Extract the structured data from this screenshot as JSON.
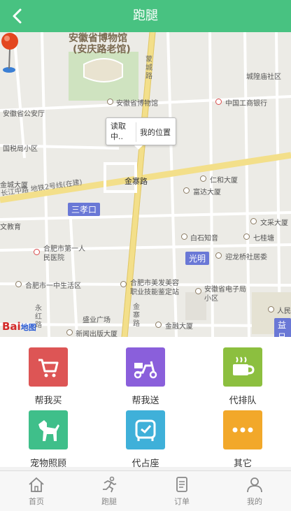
{
  "header": {
    "title": "跑腿",
    "back_icon": "chevron-left-icon"
  },
  "map": {
    "labels": {
      "museum": "安徽省博物馆",
      "museum_sub": "(安庆路老馆)",
      "museum_poi": "安徽省博物馆",
      "mengcheng_road": "蒙城路",
      "chenglong": "城隍庙社区",
      "icbc": "中国工商银行",
      "gongan": "安徽省公安厅",
      "guoshui": "国税局小区",
      "jinchengdasha": "金城大厦",
      "renhe": "仁和大厦",
      "fuda": "富达大厦",
      "metro": "长江中路 地铁2号线(在建)",
      "jinzhai": "金寨路",
      "sanxiaokou": "三孝口",
      "wenjiao": "文教育",
      "wenmi": "文采大厦",
      "baishi": "白石知音",
      "qigui": "七桂塘",
      "guangming": "光明",
      "yingshe": "迎龙桥社居委",
      "hospital": "合肥市第一人民医院",
      "yizhong": "合肥市一中生活区",
      "meifa": "合肥市美发美容职业技能鉴定站",
      "dianzi": "安徽省电子局小区",
      "yonghe": "永红路",
      "shengyi": "盛业广场",
      "jinrong": "金融大厦",
      "jinzhai2": "金寨路",
      "xinwen": "新闻出版大厦",
      "renmin": "人民",
      "yida": "益日",
      "baidu_logo": "Bai",
      "baidu_sub": "地图"
    },
    "bubble": {
      "reading": "读取中..",
      "my_location": "我的位置"
    }
  },
  "services": [
    {
      "label": "帮我买",
      "icon": "cart-icon",
      "color": "#dd5555"
    },
    {
      "label": "帮我送",
      "icon": "scooter-icon",
      "color": "#8a5fdb"
    },
    {
      "label": "代排队",
      "icon": "coffee-icon",
      "color": "#8cbf3f"
    },
    {
      "label": "宠物照顾",
      "icon": "dog-icon",
      "color": "#3fbf8a"
    },
    {
      "label": "代占座",
      "icon": "seat-icon",
      "color": "#3fb0d9"
    },
    {
      "label": "其它",
      "icon": "more-icon",
      "color": "#f2a82a"
    }
  ],
  "nav": [
    {
      "label": "首页",
      "icon": "home-icon"
    },
    {
      "label": "跑腿",
      "icon": "runner-icon"
    },
    {
      "label": "订单",
      "icon": "order-icon"
    },
    {
      "label": "我的",
      "icon": "user-icon"
    }
  ]
}
